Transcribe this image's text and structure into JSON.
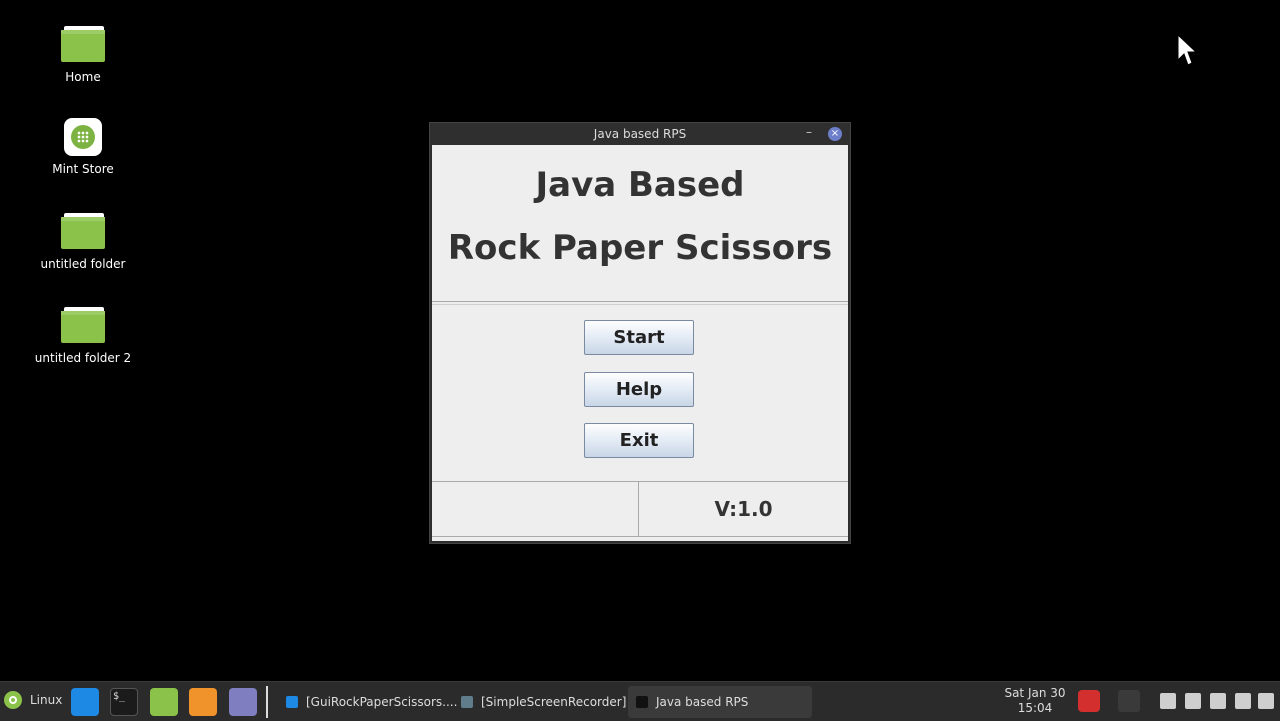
{
  "desktop": {
    "icons": [
      {
        "label": "Home",
        "icon": "folder-icon"
      },
      {
        "label": "Mint Store",
        "icon": "mint-store-icon"
      },
      {
        "label": "untitled folder",
        "icon": "folder-icon"
      },
      {
        "label": "untitled folder 2",
        "icon": "folder-icon"
      }
    ]
  },
  "window": {
    "title": "Java based RPS",
    "minimize_symbol": "–",
    "close_symbol": "×",
    "heading_line1": "Java Based",
    "heading_line2": "Rock Paper Scissors",
    "buttons": {
      "start": "Start",
      "help": "Help",
      "exit": "Exit"
    },
    "status_left": "",
    "version": "V:1.0"
  },
  "taskbar": {
    "menu_label": "Linux",
    "launchers": [
      "vscode-icon",
      "terminal-icon",
      "files-icon",
      "firefox-icon",
      "text-editor-icon"
    ],
    "terminal_glyph": "$_",
    "tasks": [
      {
        "label": "[GuiRockPaperScissors....",
        "icon": "vscode-icon"
      },
      {
        "label": "[SimpleScreenRecorder]",
        "icon": "screen-recorder-icon"
      },
      {
        "label": "Java based RPS",
        "icon": "java-icon"
      }
    ],
    "clock": {
      "date": "Sat Jan 30",
      "time": "15:04"
    }
  },
  "colors": {
    "desktop_bg": "#000000",
    "window_client": "#eeeeee",
    "accent_green": "#8bc34a",
    "close_button": "#6d7fcb"
  }
}
